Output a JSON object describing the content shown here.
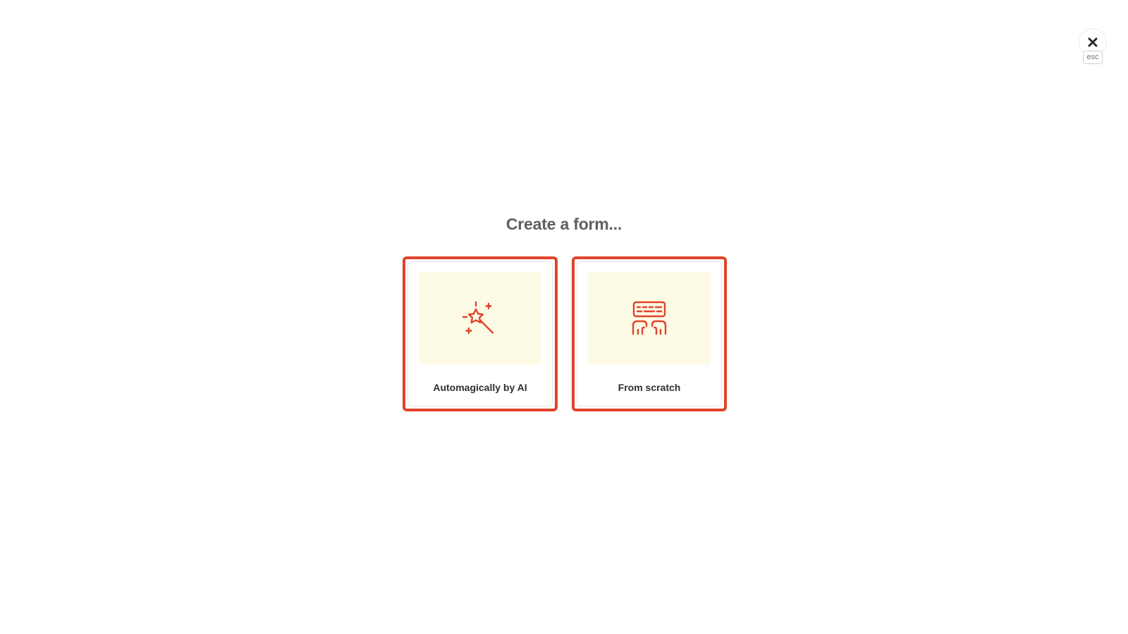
{
  "close": {
    "icon": "close-icon",
    "shortcut_label": "esc"
  },
  "title": "Create a form...",
  "options": [
    {
      "label": "Automagically by AI",
      "icon": "magic-wand-icon"
    },
    {
      "label": "From scratch",
      "icon": "keyboard-typing-icon"
    }
  ],
  "colors": {
    "accent": "#e0442b",
    "illustration_bg": "#fdfbe6",
    "title": "#5f5f5f"
  }
}
